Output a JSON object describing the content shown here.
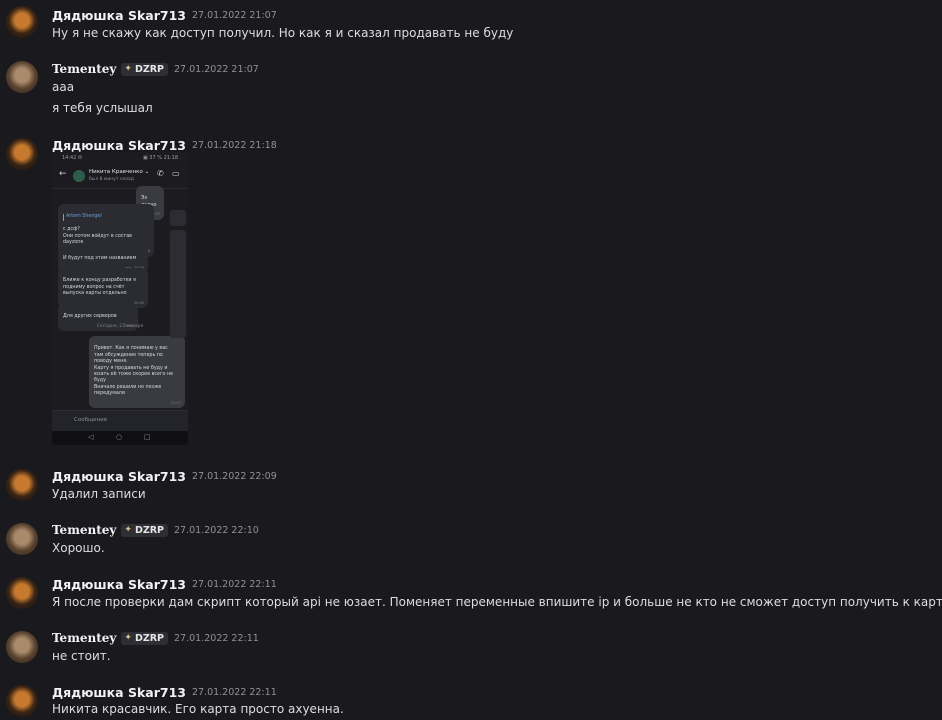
{
  "messages": [
    {
      "author": "Дядюшка Skar713",
      "timestamp": "27.01.2022 21:07",
      "lines": [
        "Ну я не скажу как доступ получил. Но как я и сказал продавать  не буду"
      ]
    },
    {
      "author": "Tementey",
      "tag": "DZRP",
      "timestamp": "27.01.2022 21:07",
      "lines": [
        "ааа",
        "я тебя услышал"
      ]
    },
    {
      "author": "Дядюшка Skar713",
      "timestamp": "27.01.2022 21:18"
    },
    {
      "author": "Дядюшка Skar713",
      "timestamp": "27.01.2022 22:09",
      "lines": [
        "Удалил записи"
      ]
    },
    {
      "author": "Tementey",
      "tag": "DZRP",
      "timestamp": "27.01.2022 22:10",
      "lines": [
        "Хорошо."
      ]
    },
    {
      "author": "Дядюшка Skar713",
      "timestamp": "27.01.2022 22:11",
      "lines": [
        "Я после проверки дам скрипт который api не юзает. Поменяет переменные впишите ip и больше не кто не сможет доступ получить к карте"
      ]
    },
    {
      "author": "Tementey",
      "tag": "DZRP",
      "timestamp": "27.01.2022 22:11",
      "lines": [
        "не стоит."
      ]
    },
    {
      "author": "Дядюшка Skar713",
      "timestamp": "27.01.2022 22:11",
      "lines": [
        "Никита красавчик. Его карта просто ахуенна."
      ]
    }
  ],
  "attachment": {
    "status_left": "14:42 ✉",
    "status_right": "▣ 37 % 21:18",
    "contact_name": "Никита Кравченко ⌄",
    "contact_status": "был 8 минут назад",
    "bubbles": [
      {
        "text": "Ээ ладно",
        "time": "20:37"
      },
      {
        "quote": "Artem Shengel",
        "text": "с дсф?\nОни потом войдут в состав\ndayzone",
        "time": "20:38"
      },
      {
        "text": "И будут под этим названием",
        "time": "ред. 20:39"
      },
      {
        "text": "Ближе к концу разработки я\nподниму вопрос на счёт\nвыпуска карты отдельно",
        "time": "20:40"
      },
      {
        "text": "Для других серверов",
        "time": "20:41"
      },
      {
        "text": "Привет. Как я понимаю у вас\nтам обсуждение теперь по\nповоду меня.\nКарту я продавать не буду и\nюзать её тоже скорее всего не\nбуду\nВначале решили но позже\nпередумали",
        "time": "21:17"
      }
    ],
    "date_divider": "Сегодня, 27 января",
    "input_placeholder": "Сообщение"
  },
  "icons": {
    "tag_icon": "diamond-icon",
    "back": "arrow-left-icon",
    "call": "phone-icon",
    "video": "video-icon"
  },
  "colors": {
    "background": "#1a1a1e",
    "username": "#f2f3f5",
    "text": "#dbdee1",
    "timestamp": "#8e9297"
  }
}
